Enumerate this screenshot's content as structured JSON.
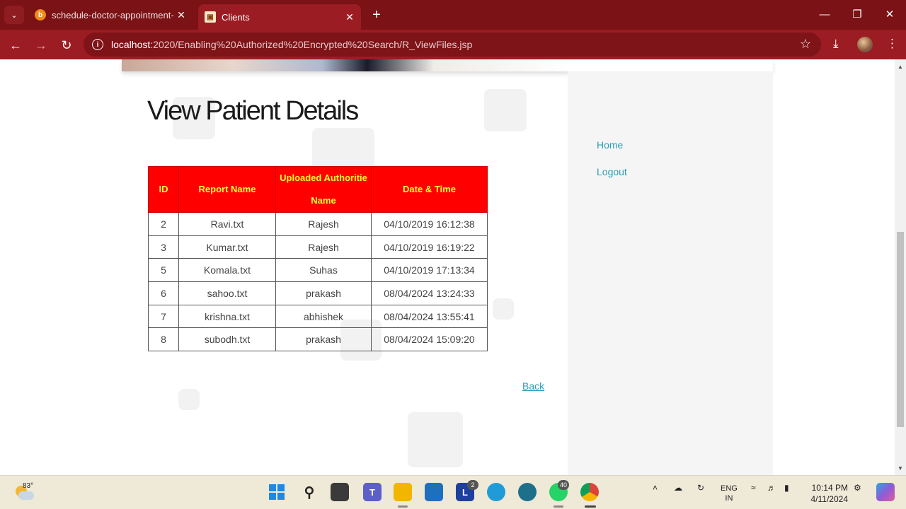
{
  "browser": {
    "tabs": [
      {
        "title": "schedule-doctor-appointment-",
        "active": false
      },
      {
        "title": "Clients",
        "active": true
      }
    ],
    "url_host": "localhost",
    "url_path": ":2020/Enabling%20Authorized%20Encrypted%20Search/R_ViewFiles.jsp"
  },
  "page": {
    "title": "View Patient Details",
    "table": {
      "headers": {
        "id": "ID",
        "report_name": "Report Name",
        "uploaded_by": "Uploaded Authoritie Name",
        "datetime": "Date & Time"
      },
      "rows": [
        {
          "id": "2",
          "report_name": "Ravi.txt",
          "uploaded_by": "Rajesh",
          "datetime": "04/10/2019 16:12:38"
        },
        {
          "id": "3",
          "report_name": "Kumar.txt",
          "uploaded_by": "Rajesh",
          "datetime": "04/10/2019 16:19:22"
        },
        {
          "id": "5",
          "report_name": "Komala.txt",
          "uploaded_by": "Suhas",
          "datetime": "04/10/2019 17:13:34"
        },
        {
          "id": "6",
          "report_name": "sahoo.txt",
          "uploaded_by": "prakash",
          "datetime": "08/04/2024 13:24:33"
        },
        {
          "id": "7",
          "report_name": "krishna.txt",
          "uploaded_by": "abhishek",
          "datetime": "08/04/2024 13:55:41"
        },
        {
          "id": "8",
          "report_name": "subodh.txt",
          "uploaded_by": "prakash",
          "datetime": "08/04/2024 15:09:20"
        }
      ]
    },
    "back_label": "Back"
  },
  "sidebar": {
    "links": [
      "Home",
      "Logout"
    ]
  },
  "taskbar": {
    "temperature": "83°",
    "badges": {
      "l_app": "2",
      "whatsapp": "40"
    },
    "lang_line1": "ENG",
    "lang_line2": "IN",
    "time": "10:14 PM",
    "date": "4/11/2024"
  },
  "colors": {
    "chrome_dark": "#7a1216",
    "chrome_toolbar": "#9b1c22",
    "table_header_bg": "#ff0000",
    "table_header_text": "#ffff33",
    "link": "#2a9fb3"
  }
}
